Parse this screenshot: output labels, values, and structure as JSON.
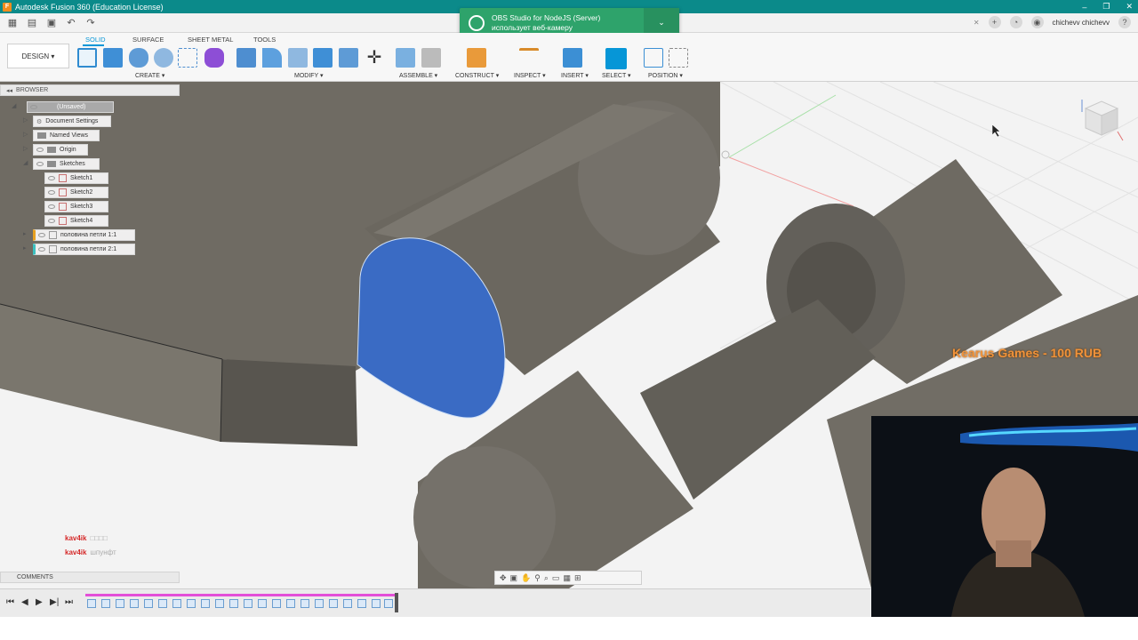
{
  "window": {
    "title": "Autodesk Fusion 360 (Education License)",
    "app_icon": "F",
    "min": "–",
    "max": "❐",
    "close": "✕"
  },
  "user": {
    "name": "chichevv chichevv"
  },
  "notification": {
    "line1": "OBS Studio for NodeJS (Server)",
    "line2": "использует веб-камеру",
    "expand": "⌄"
  },
  "toolbar": {
    "workspace": "DESIGN ▾",
    "tabs": [
      "SOLID",
      "SURFACE",
      "SHEET METAL",
      "TOOLS"
    ],
    "groups": [
      "CREATE ▾",
      "MODIFY ▾",
      "ASSEMBLE ▾",
      "CONSTRUCT ▾",
      "INSPECT ▾",
      "INSERT ▾",
      "SELECT ▾",
      "POSITION ▾"
    ]
  },
  "browser": {
    "title": "BROWSER",
    "root": "(Unsaved)",
    "items": [
      "Document Settings",
      "Named Views",
      "Origin",
      "Sketches",
      "Sketch1",
      "Sketch2",
      "Sketch3",
      "Sketch4",
      "половина петли 1:1",
      "половина петли 2:1"
    ]
  },
  "comments": {
    "title": "COMMENTS"
  },
  "overlay": {
    "donation": "Kearus Games - 100 RUB"
  },
  "chat": [
    {
      "user": "kav4ik",
      "msg": "□□□□"
    },
    {
      "user": "kav4ik",
      "msg": "шпунфт"
    }
  ],
  "colors": {
    "titlebar": "#0b8a8a",
    "accent": "#0696d7",
    "selected_face": "#3a6bc4",
    "body": "#6e6a62",
    "notification": "#2ea36b",
    "timeline_track": "#e34fd8",
    "donation_text": "#f0923a"
  },
  "icons": {
    "nav": [
      "orbit-icon",
      "look-at-icon",
      "pan-icon",
      "zoom-icon",
      "fit-icon",
      "display-icon",
      "grid-icon",
      "viewports-icon"
    ],
    "timeline_controls": [
      "⏮",
      "◀",
      "▶",
      "▶|",
      "⏭"
    ]
  }
}
